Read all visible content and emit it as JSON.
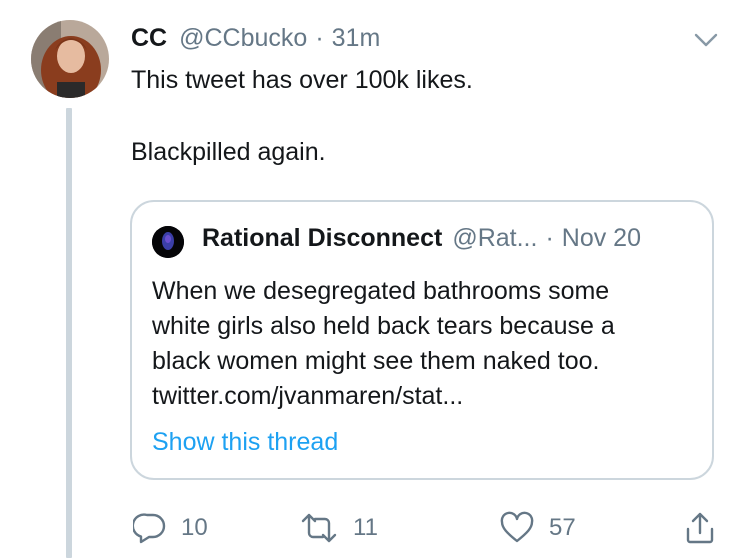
{
  "tweet": {
    "name": "CC",
    "handle": "@CCbucko",
    "separator": "·",
    "time": "31m",
    "text_lines": [
      "This tweet has over 100k likes.",
      "Blackpilled again."
    ]
  },
  "quote": {
    "name": "Rational Disconnect",
    "handle": "@Rat...",
    "separator": "·",
    "date": "Nov 20",
    "text_lines": [
      "When we desegregated bathrooms some",
      "white girls also held back tears because a",
      "black women might see them naked too.",
      "twitter.com/jvanmaren/stat..."
    ],
    "show_thread": "Show this thread"
  },
  "actions": {
    "replies": "10",
    "retweets": "11",
    "likes": "57"
  },
  "colors": {
    "text": "#14171a",
    "secondary": "#657786",
    "link": "#1da1f2",
    "border": "#ccd6dd"
  },
  "icons": [
    "chevron-down-icon",
    "reply-icon",
    "retweet-icon",
    "like-icon",
    "share-icon"
  ]
}
